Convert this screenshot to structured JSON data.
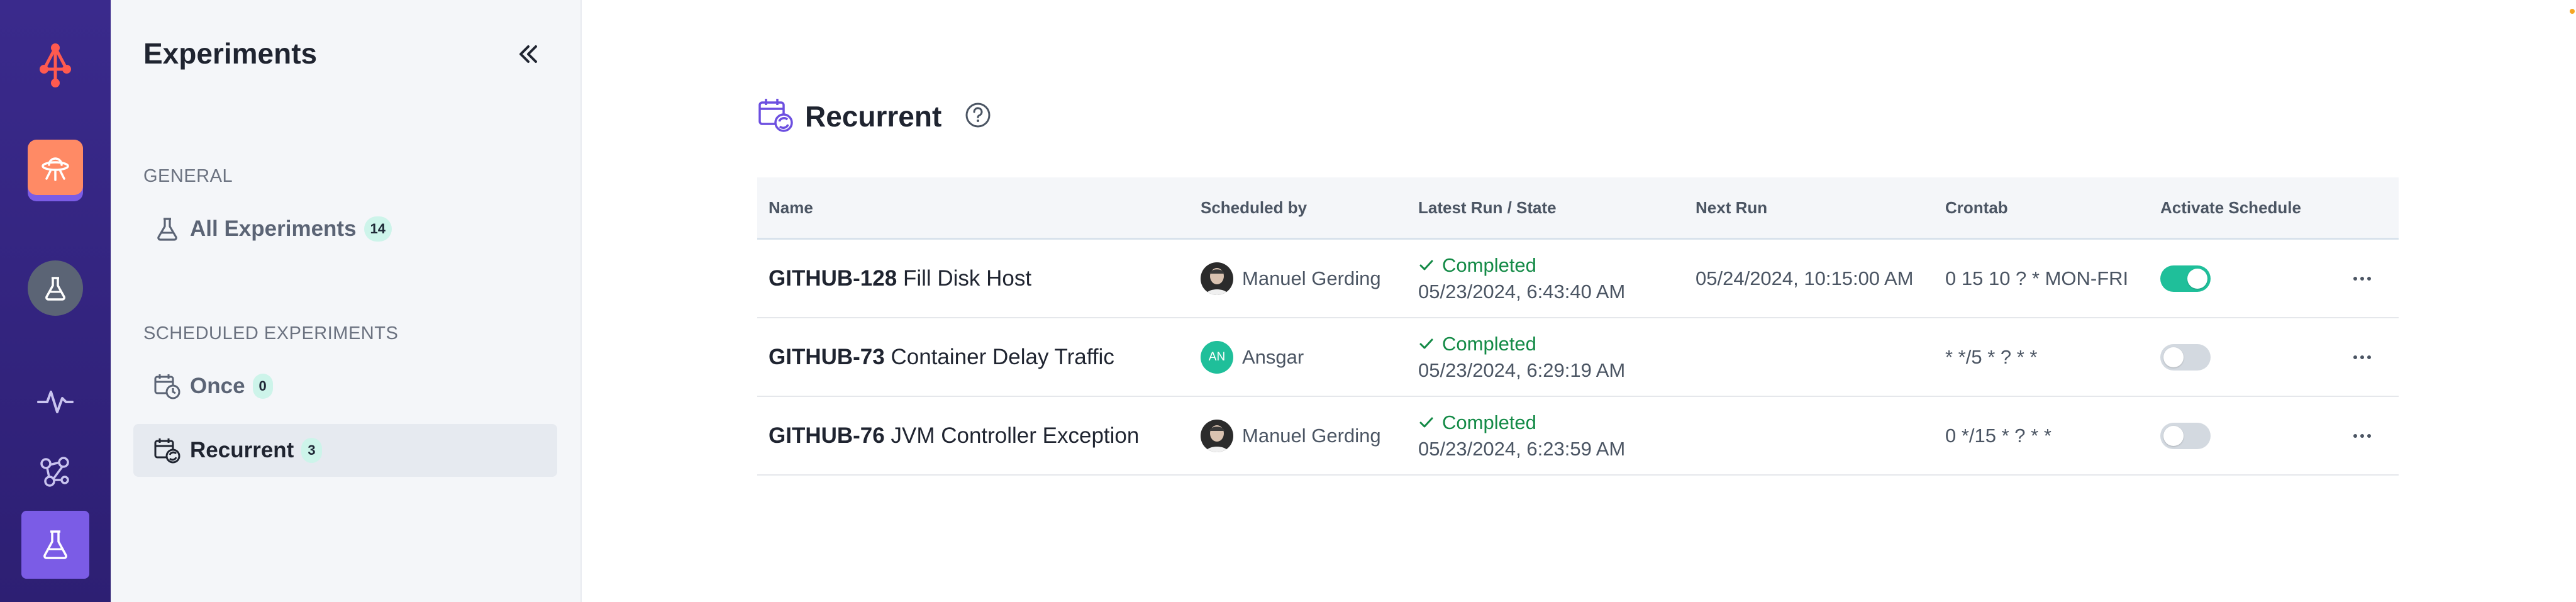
{
  "rail": {
    "items": [
      "logo-icon",
      "ufo-icon",
      "flask-icon",
      "activity-icon",
      "graph-icon",
      "experiments-icon"
    ],
    "accent": "#ff8a65",
    "active_color": "#6c4fe0"
  },
  "subnav": {
    "title": "Experiments",
    "general_label": "GENERAL",
    "all_experiments": {
      "label": "All Experiments",
      "count": "14"
    },
    "scheduled_label": "SCHEDULED EXPERIMENTS",
    "once": {
      "label": "Once",
      "count": "0"
    },
    "recurrent": {
      "label": "Recurrent",
      "count": "3"
    }
  },
  "main": {
    "title": "Recurrent",
    "columns": [
      "Name",
      "Scheduled by",
      "Latest Run / State",
      "Next Run",
      "Crontab",
      "Activate Schedule"
    ],
    "rows": [
      {
        "key": "GITHUB-128",
        "name": "Fill Disk Host",
        "scheduled_by": "Manuel Gerding",
        "avatar": "photo",
        "state": "Completed",
        "latest_run": "05/23/2024, 6:43:40 AM",
        "next_run": "05/24/2024, 10:15:00 AM",
        "crontab": "0 15 10 ? * MON-FRI",
        "active": true
      },
      {
        "key": "GITHUB-73",
        "name": "Container Delay Traffic",
        "scheduled_by": "Ansgar",
        "avatar": "AN",
        "state": "Completed",
        "latest_run": "05/23/2024, 6:29:19 AM",
        "next_run": "",
        "crontab": "* */5 * ? * *",
        "active": false
      },
      {
        "key": "GITHUB-76",
        "name": "JVM Controller Exception",
        "scheduled_by": "Manuel Gerding",
        "avatar": "photo",
        "state": "Completed",
        "latest_run": "05/23/2024, 6:23:59 AM",
        "next_run": "",
        "crontab": "0 */15 * ? * *",
        "active": false
      }
    ]
  },
  "colors": {
    "success": "#138a46",
    "toggle_on": "#1fbf9a",
    "badge": "#cdf4ea"
  }
}
